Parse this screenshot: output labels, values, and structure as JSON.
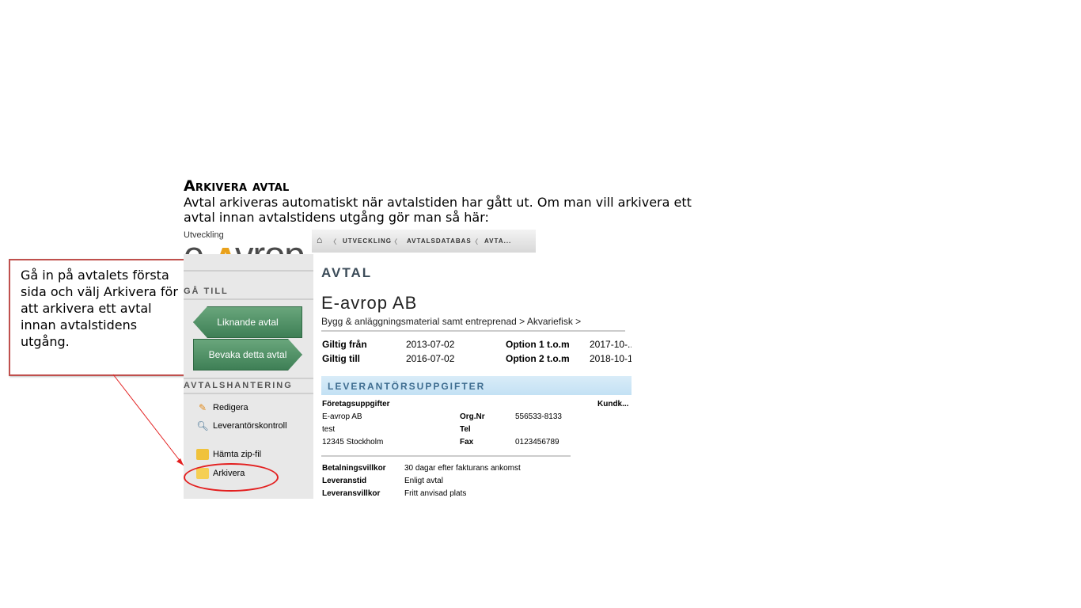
{
  "slide": {
    "heading": "Arkivera avtal",
    "intro": "Avtal arkiveras automatiskt när avtalstiden har gått ut.  Om man vill arkivera ett avtal innan avtalstidens utgång gör man så här:",
    "callout": "Gå in på avtalets första sida och välj Arkivera för att arkivera ett avtal innan avtalstidens utgång."
  },
  "app": {
    "env_label": "Utveckling",
    "logo": {
      "pre": "e-",
      "lam": "ʌ",
      "post": "vrop"
    },
    "breadcrumbs": [
      "UTVECKLING",
      "AVTALSDATABAS",
      "AVTA..."
    ],
    "sidebar": {
      "goto_header": "GÅ TILL",
      "goto_buttons": [
        "Liknande avtal",
        "Bevaka detta avtal"
      ],
      "manage_header": "AVTALSHANTERING",
      "items": [
        {
          "label": "Redigera",
          "icon": "pencil-icon"
        },
        {
          "label": "Leverantörskontroll",
          "icon": "magnifier-icon"
        },
        {
          "label": "Hämta zip-fil",
          "icon": "zip-folder-icon"
        },
        {
          "label": "Arkivera",
          "icon": "folder-icon"
        }
      ]
    },
    "main": {
      "section_title": "AVTAL",
      "supplier_name": "E-avrop AB",
      "category_path": "Bygg & anläggningsmaterial samt entreprenad > Akvariefisk >",
      "dates": [
        {
          "label": "Giltig från",
          "value": "2013-07-02",
          "opt_label": "Option 1 t.o.m",
          "opt_value": "2017-10-..."
        },
        {
          "label": "Giltig till",
          "value": "2016-07-02",
          "opt_label": "Option 2 t.o.m",
          "opt_value": "2018-10-1..."
        }
      ],
      "supplier_band": "LEVERANTÖRSUPPGIFTER",
      "company": {
        "header": "Företagsuppgifter",
        "right_header": "Kundk...",
        "lines": [
          "E-avrop AB",
          "test",
          "12345 Stockholm"
        ],
        "fields": [
          {
            "label": "Org.Nr",
            "value": "556533-8133"
          },
          {
            "label": "Tel",
            "value": ""
          },
          {
            "label": "Fax",
            "value": "0123456789"
          }
        ]
      },
      "terms": [
        {
          "label": "Betalningsvillkor",
          "value": "30 dagar efter fakturans ankomst"
        },
        {
          "label": "Leveranstid",
          "value": "Enligt avtal"
        },
        {
          "label": "Leveransvillkor",
          "value": "Fritt anvisad plats"
        }
      ]
    }
  },
  "colors": {
    "callout_border": "#c0504d",
    "highlight_circle": "#e32020",
    "button_green": "#4f8f64",
    "band_blue": "#c3e1f4"
  }
}
